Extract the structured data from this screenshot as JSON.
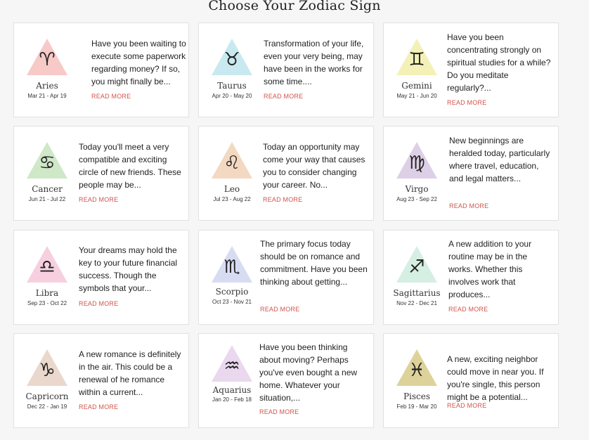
{
  "title": "Choose Your Zodiac Sign",
  "read_more": "READ MORE",
  "signs": [
    {
      "name": "Aries",
      "dates": "Mar 21 - Apr 19",
      "color": "#f7c9c7",
      "glyph": "♈",
      "text": "Have you been waiting to execute some paperwork regarding money? If so, you might finally be...",
      "icon": "aries-icon"
    },
    {
      "name": "Taurus",
      "dates": "Apr 20 - May 20",
      "color": "#c8e9ef",
      "glyph": "♉",
      "text": "Transformation of your life, even your very being, may have been in the works for some time....",
      "icon": "taurus-icon"
    },
    {
      "name": "Gemini",
      "dates": "May 21 - Jun 20",
      "color": "#f3f1b7",
      "glyph": "♊",
      "text": "Have you been concentrating strongly on spiritual studies for a while? Do you meditate regularly?...",
      "icon": "gemini-icon"
    },
    {
      "name": "Cancer",
      "dates": "Jun 21 - Jul 22",
      "color": "#cfe8c8",
      "glyph": "♋",
      "text": "Today you'll meet a very compatible and exciting circle of new friends. These people may be...",
      "icon": "cancer-icon"
    },
    {
      "name": "Leo",
      "dates": "Jul 23 - Aug 22",
      "color": "#f3d9c2",
      "glyph": "♌",
      "text": "Today an opportunity may come your way that causes you to consider changing your career. No...",
      "icon": "leo-icon"
    },
    {
      "name": "Virgo",
      "dates": "Aug 23 - Sep 22",
      "color": "#ddd0e6",
      "glyph": "♍",
      "text": "New beginnings are heralded today, particularly where travel, education, and legal matters...",
      "icon": "virgo-icon"
    },
    {
      "name": "Libra",
      "dates": "Sep 23 - Oct 22",
      "color": "#f6d0de",
      "glyph": "♎",
      "text": "Your dreams may hold the key to your future financial success. Though the symbols that your...",
      "icon": "libra-icon"
    },
    {
      "name": "Scorpio",
      "dates": "Oct 23 - Nov 21",
      "color": "#d8dcf3",
      "glyph": "♏",
      "text": "The primary focus today should be on romance and commitment. Have you been thinking about getting...",
      "icon": "scorpio-icon"
    },
    {
      "name": "Sagittarius",
      "dates": "Nov 22 - Dec 21",
      "color": "#d5efe3",
      "glyph": "♐",
      "text": "A new addition to your routine may be in the works. Whether this involves work that produces...",
      "icon": "sagittarius-icon"
    },
    {
      "name": "Capricorn",
      "dates": "Dec 22 - Jan 19",
      "color": "#ead8cd",
      "glyph": "♑",
      "text": "A new romance is definitely in the air. This could be a renewal of he romance within a current...",
      "icon": "capricorn-icon"
    },
    {
      "name": "Aquarius",
      "dates": "Jan 20 - Feb 18",
      "color": "#ead8ef",
      "glyph": "♒",
      "text": "Have you been thinking about moving? Perhaps you've even bought a new home. Whatever your situation,...",
      "icon": "aquarius-icon"
    },
    {
      "name": "Pisces",
      "dates": "Feb 19 - Mar 20",
      "color": "#ddd29a",
      "glyph": "♓",
      "text": "A new, exciting neighbor could move in near you. If you're single, this person might be a potential...",
      "icon": "pisces-icon"
    }
  ]
}
